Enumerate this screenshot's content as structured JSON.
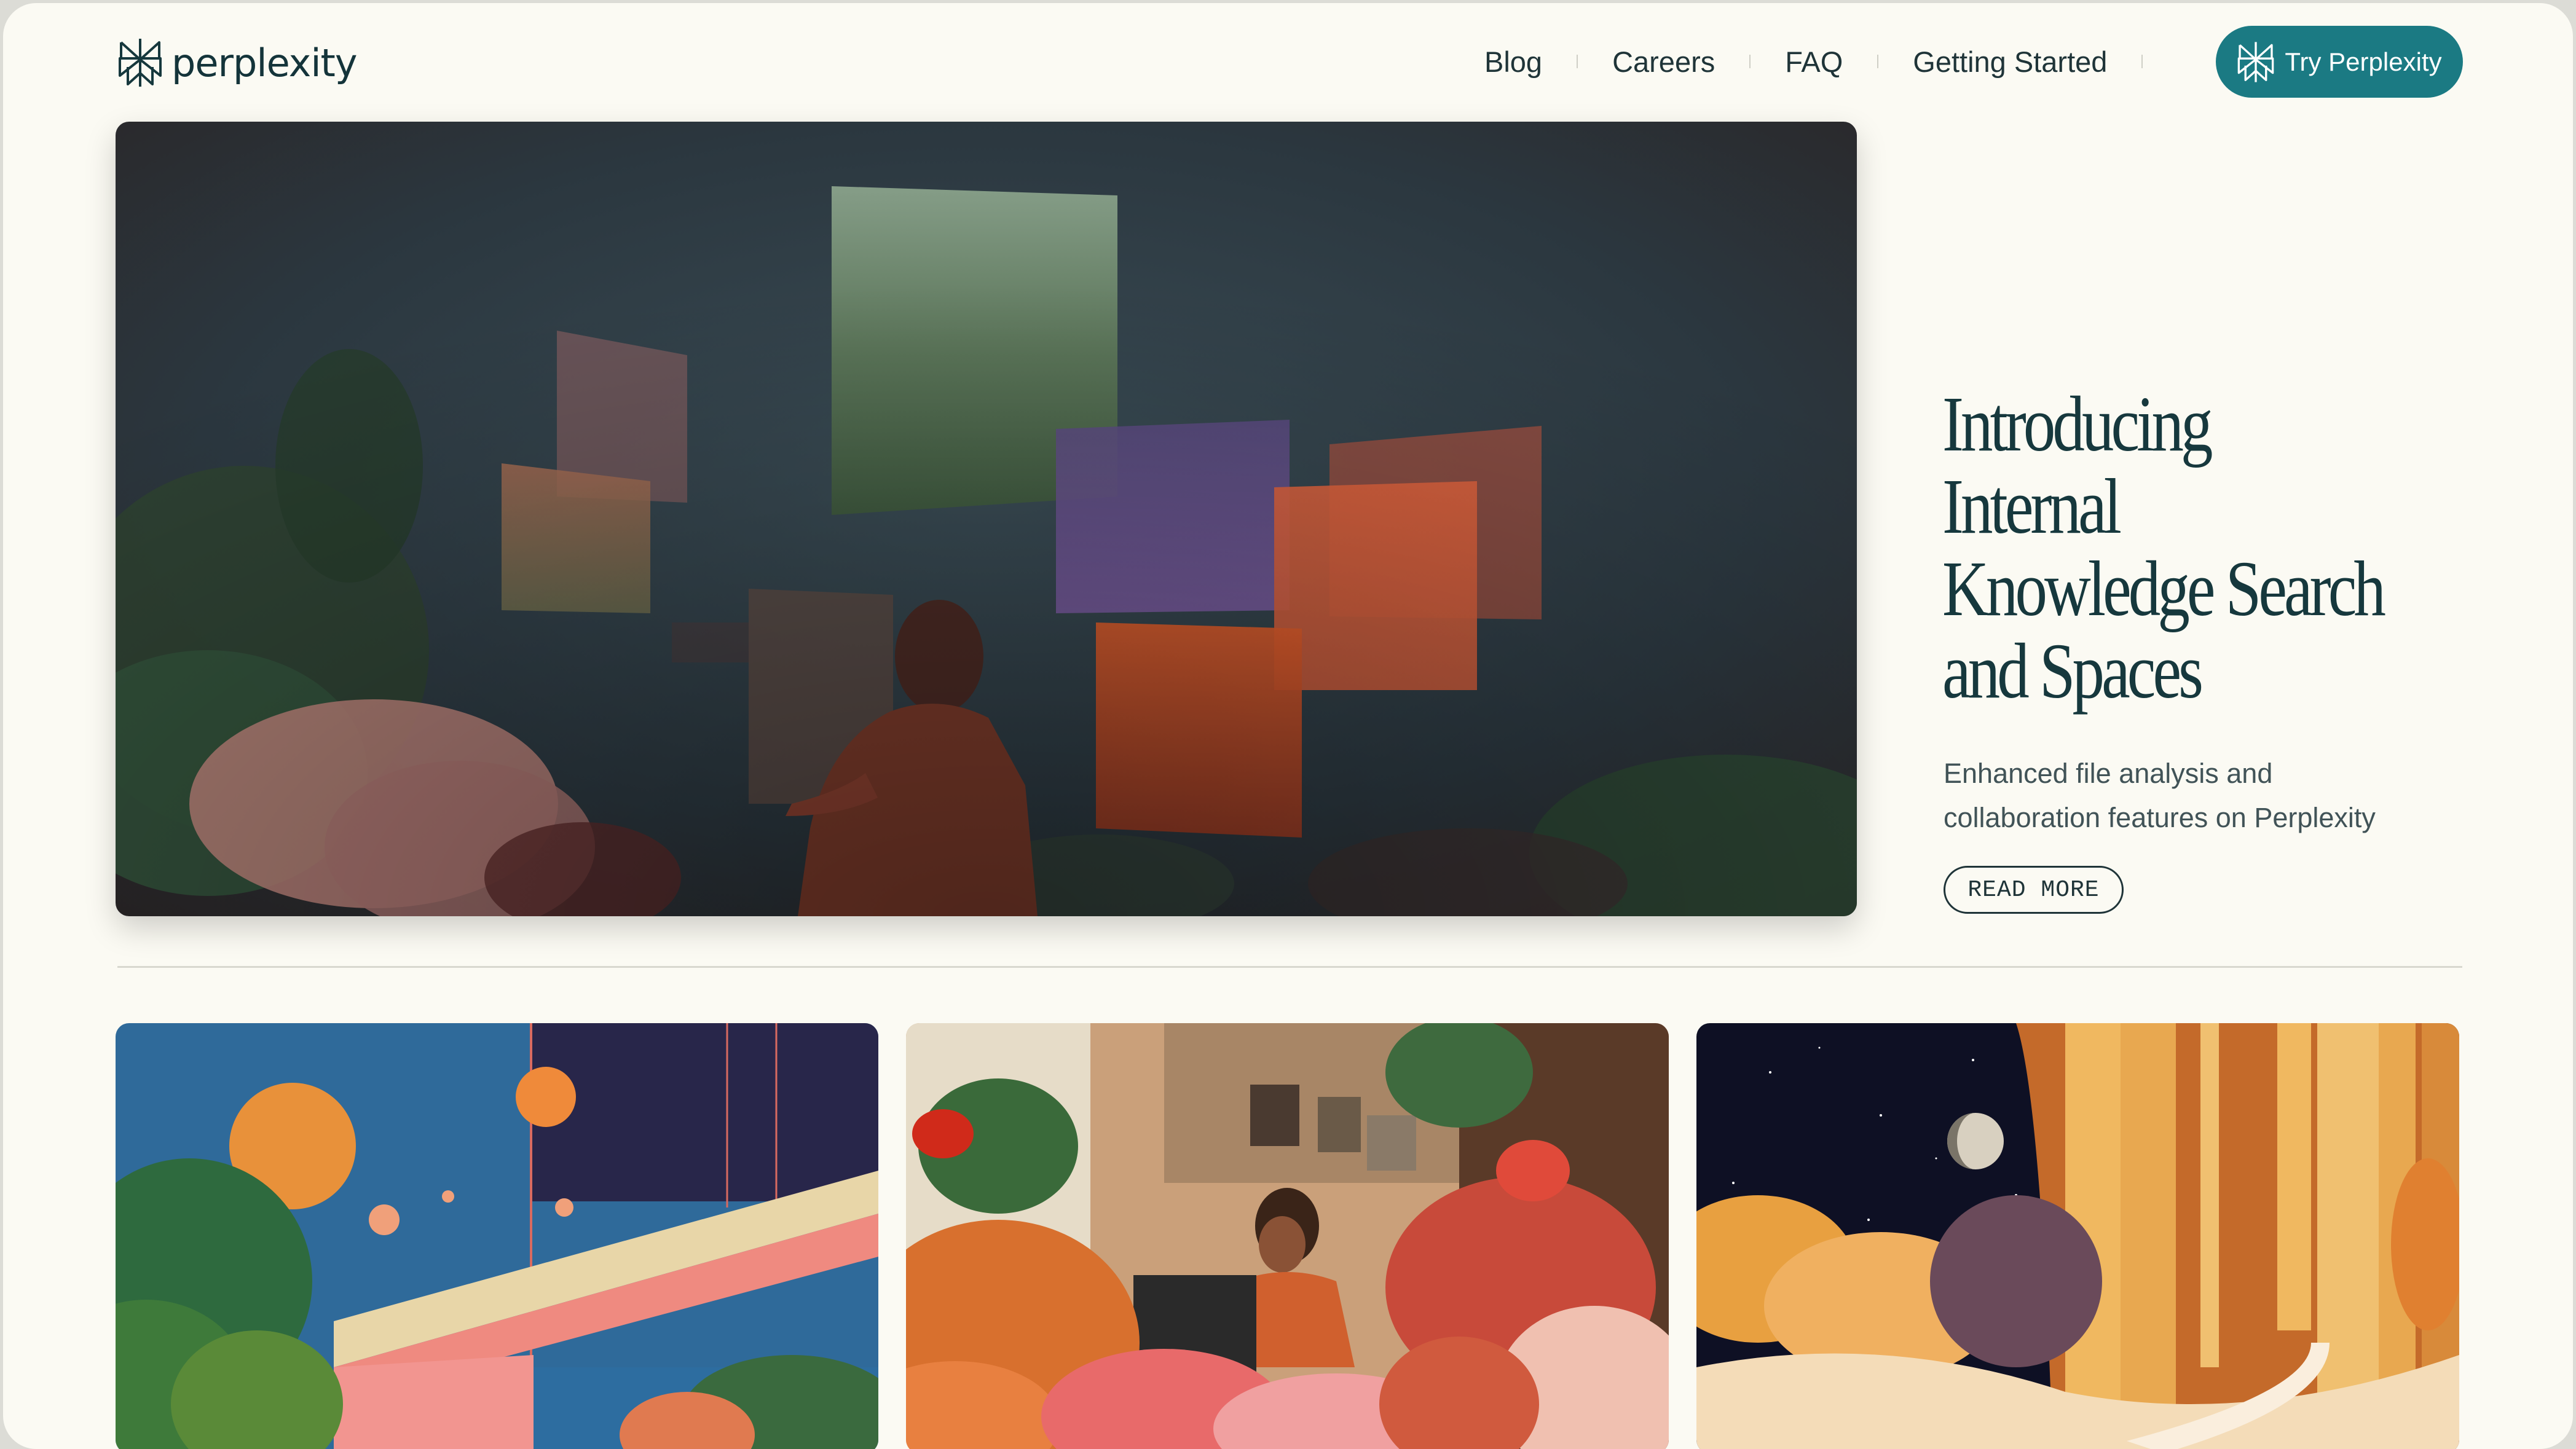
{
  "header": {
    "logo_text": "perplexity",
    "nav": [
      {
        "label": "Blog"
      },
      {
        "label": "Careers"
      },
      {
        "label": "FAQ"
      },
      {
        "label": "Getting Started"
      }
    ],
    "cta_label": "Try Perplexity"
  },
  "hero": {
    "title_lines": [
      "Introducing",
      "Internal",
      "Knowledge Search",
      "and Spaces"
    ],
    "subtitle_lines": [
      "Enhanced file analysis and",
      "collaboration features on Perplexity"
    ],
    "read_more": "READ MORE",
    "image": "person-among-floating-nature-screens"
  },
  "cards": [
    {
      "image": "retro-architecture-moons-illustration"
    },
    {
      "image": "woman-laptop-among-flowers"
    },
    {
      "image": "moon-golden-pillars-landscape"
    }
  ],
  "colors": {
    "page_background": "#fbfaf3",
    "brand_teal": "#1b7a83",
    "text_dark": "#16383d",
    "text_muted": "#415357"
  }
}
